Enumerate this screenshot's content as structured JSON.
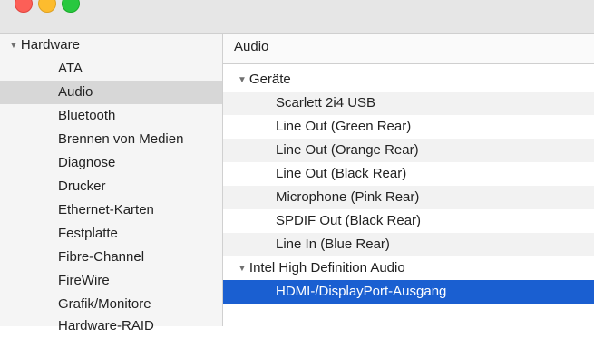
{
  "sidebar": {
    "section_label": "Hardware",
    "items": [
      {
        "label": "ATA"
      },
      {
        "label": "Audio"
      },
      {
        "label": "Bluetooth"
      },
      {
        "label": "Brennen von Medien"
      },
      {
        "label": "Diagnose"
      },
      {
        "label": "Drucker"
      },
      {
        "label": "Ethernet-Karten"
      },
      {
        "label": "Festplatte"
      },
      {
        "label": "Fibre-Channel"
      },
      {
        "label": "FireWire"
      },
      {
        "label": "Grafik/Monitore"
      },
      {
        "label": "Hardware-RAID"
      }
    ],
    "selected_item": "Audio"
  },
  "main": {
    "title": "Audio",
    "groups": [
      {
        "label": "Geräte",
        "items": [
          "Scarlett 2i4 USB",
          "Line Out (Green Rear)",
          "Line Out (Orange Rear)",
          "Line Out (Black Rear)",
          "Microphone (Pink Rear)",
          "SPDIF Out (Black Rear)",
          "Line In (Blue Rear)"
        ]
      },
      {
        "label": "Intel High Definition Audio",
        "items": [
          "HDMI-/DisplayPort-Ausgang"
        ]
      }
    ],
    "selected_item": "HDMI-/DisplayPort-Ausgang"
  },
  "colors": {
    "selection_blue": "#1a5fd1",
    "sidebar_selection": "#d7d7d7"
  }
}
